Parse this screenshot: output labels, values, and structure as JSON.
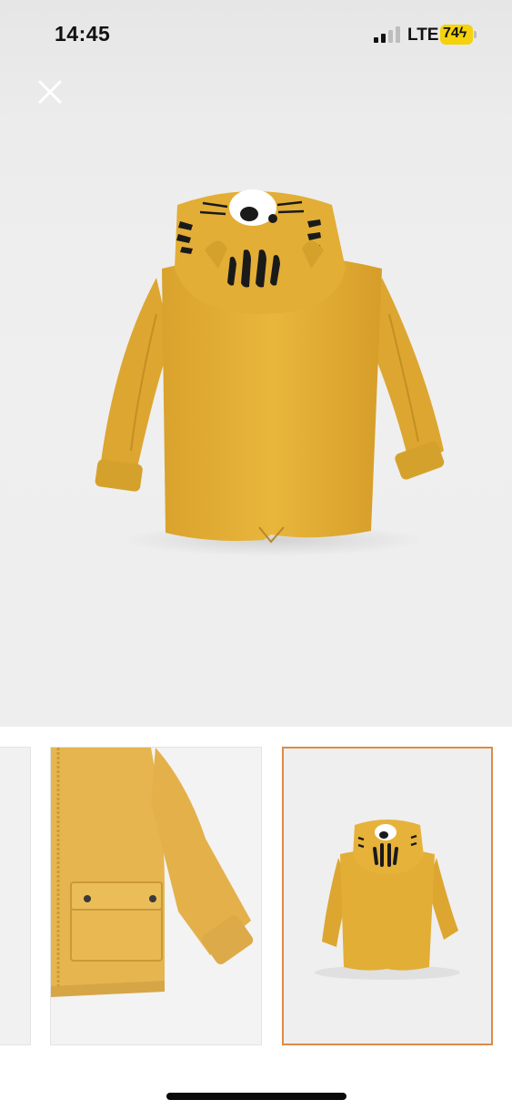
{
  "status_bar": {
    "time": "14:45",
    "network": "LTE",
    "battery_level": "74",
    "battery_color": "#f5d20b"
  },
  "viewer": {
    "close_icon": "close-icon",
    "main_image": "yellow-hooded-jacket-back-view",
    "jacket_color": "#e8b43a"
  },
  "thumbnails": {
    "items": [
      {
        "name": "jacket-side-partial",
        "selected": false
      },
      {
        "name": "jacket-pocket-detail",
        "selected": false
      },
      {
        "name": "jacket-back-view",
        "selected": true
      }
    ],
    "selected_border_color": "#e08a45"
  }
}
